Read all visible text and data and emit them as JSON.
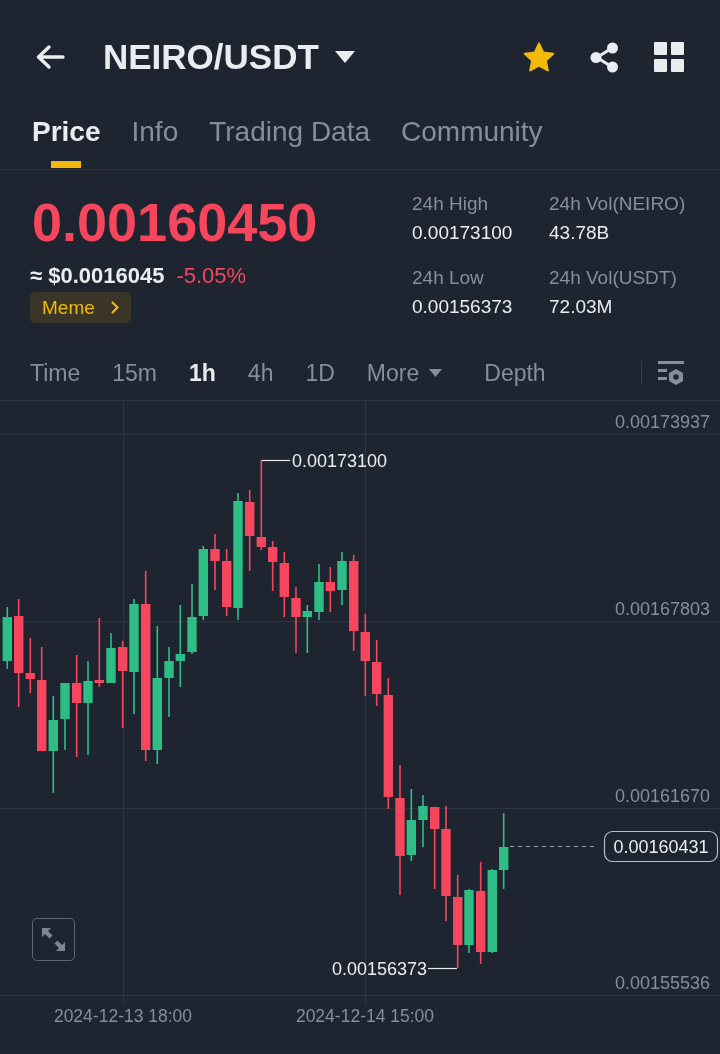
{
  "header": {
    "title": "NEIRO/USDT",
    "favorite": true
  },
  "tabs": [
    {
      "label": "Price",
      "selected": true
    },
    {
      "label": "Info",
      "selected": false
    },
    {
      "label": "Trading Data",
      "selected": false
    },
    {
      "label": "Community",
      "selected": false
    }
  ],
  "price": {
    "last": "0.00160450",
    "falling": true,
    "fiat": "≈ $0.0016045",
    "change": "-5.05%",
    "tag": "Meme"
  },
  "stats": [
    {
      "label": "24h High",
      "value": "0.00173100"
    },
    {
      "label": "24h Vol(NEIRO)",
      "value": "43.78B"
    },
    {
      "label": "24h Low",
      "value": "0.00156373"
    },
    {
      "label": "24h Vol(USDT)",
      "value": "72.03M"
    }
  ],
  "intervals": [
    {
      "label": "Time",
      "kind": "option",
      "selected": false
    },
    {
      "label": "15m",
      "kind": "option",
      "selected": false
    },
    {
      "label": "1h",
      "kind": "option",
      "selected": true
    },
    {
      "label": "4h",
      "kind": "option",
      "selected": false
    },
    {
      "label": "1D",
      "kind": "option",
      "selected": false
    },
    {
      "label": "More",
      "kind": "dropdown",
      "selected": false
    },
    {
      "label": "Depth",
      "kind": "option",
      "selected": false
    }
  ],
  "chart": {
    "price_axis": [
      "0.00173937",
      "0.00167803",
      "0.00161670",
      "0.00155536"
    ],
    "time_axis": [
      "2024-12-13 18:00",
      "2024-12-14 15:00"
    ],
    "high_marker": "0.00173100",
    "low_marker": "0.00156373",
    "last_price": "0.00160431"
  }
}
